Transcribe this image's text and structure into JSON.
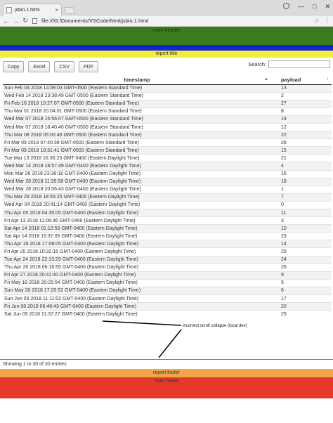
{
  "browser": {
    "tab_title": "jsbin.1.html",
    "tab_close": "×",
    "url": "file:///G:/Documents/VSCode/html/jsbin.1.html",
    "back": "←",
    "forward": "→",
    "reload": "↻",
    "star": "☆",
    "menu": "⋮",
    "minimize": "—",
    "maximize": "□",
    "close": "✕"
  },
  "page": {
    "main_header": "main header",
    "report_title": "report title",
    "report_footer": "report footer",
    "main_footer": "main footer"
  },
  "toolbar": {
    "copy": "Copy",
    "excel": "Excel",
    "csv": "CSV",
    "pdf": "PDF",
    "search_label": "Search:",
    "search_value": ""
  },
  "table": {
    "headers": [
      "timestamp",
      "payload"
    ],
    "sort_icon": "▲",
    "sort_icon2": "↕",
    "rows": [
      [
        "Sun Feb 04 2018 14:58:03 GMT-0500 (Eastern Standard Time)",
        "13"
      ],
      [
        "Wed Feb 14 2018 23:38:49 GMT-0500 (Eastern Standard Time)",
        "2"
      ],
      [
        "Fri Feb 16 2018 10:27:07 GMT-0500 (Eastern Standard Time)",
        "27"
      ],
      [
        "Thu Mar 01 2018 20:04:01 GMT-0500 (Eastern Standard Time)",
        "8"
      ],
      [
        "Wed Mar 07 2018 15:56:07 GMT-0500 (Eastern Standard Time)",
        "19"
      ],
      [
        "Wed Mar 07 2018 18:40:40 GMT-0500 (Eastern Standard Time)",
        "12"
      ],
      [
        "Thu Mar 08 2018 05:00:46 GMT-0500 (Eastern Standard Time)",
        "22"
      ],
      [
        "Fri Mar 09 2018 07:40:38 GMT-0500 (Eastern Standard Time)",
        "28"
      ],
      [
        "Fri Mar 09 2018 19:31:41 GMT-0500 (Eastern Standard Time)",
        "15"
      ],
      [
        "Tue Mar 13 2018 16:36:23 GMT-0400 (Eastern Daylight Time)",
        "21"
      ],
      [
        "Wed Mar 14 2018 18:57:49 GMT-0400 (Eastern Daylight Time)",
        "4"
      ],
      [
        "Mon Mar 26 2018 23:38:18 GMT-0400 (Eastern Daylight Time)",
        "16"
      ],
      [
        "Wed Mar 28 2018 11:35:58 GMT-0400 (Eastern Daylight Time)",
        "18"
      ],
      [
        "Wed Mar 28 2018 20:06:43 GMT-0400 (Eastern Daylight Time)",
        "1"
      ],
      [
        "Thu Mar 29 2018 18:55:25 GMT-0400 (Eastern Daylight Time)",
        "7"
      ],
      [
        "Wed Apr 04 2018 20:41:14 GMT-0400 (Eastern Daylight Time)",
        "0"
      ],
      [
        "Thu Apr 05 2018 04:35:05 GMT-0400 (Eastern Daylight Time)",
        "11"
      ],
      [
        "Fri Apr 13 2018 11:06:36 GMT-0400 (Eastern Daylight Time)",
        "3"
      ],
      [
        "Sat Apr 14 2018 01:12:53 GMT-0400 (Eastern Daylight Time)",
        "10"
      ],
      [
        "Sat Apr 14 2018 15:37:05 GMT-0400 (Eastern Daylight Time)",
        "23"
      ],
      [
        "Thu Apr 19 2018 17:08:05 GMT-0400 (Eastern Daylight Time)",
        "14"
      ],
      [
        "Fri Apr 20 2018 10:32:15 GMT-0400 (Eastern Daylight Time)",
        "29"
      ],
      [
        "Tue Apr 24 2018 22:13:29 GMT-0400 (Eastern Daylight Time)",
        "24"
      ],
      [
        "Thu Apr 26 2018 06:16:55 GMT-0400 (Eastern Daylight Time)",
        "26"
      ],
      [
        "Fri Apr 27 2018 20:41:40 GMT-0400 (Eastern Daylight Time)",
        "9"
      ],
      [
        "Fri May 18 2018 20:25:54 GMT-0400 (Eastern Daylight Time)",
        "5"
      ],
      [
        "Sun May 20 2018 17:20:52 GMT-0400 (Eastern Daylight Time)",
        "6"
      ],
      [
        "Sun Jun 03 2018 11:11:02 GMT-0400 (Eastern Daylight Time)",
        "17"
      ],
      [
        "Fri Jun 08 2018 06:46:43 GMT-0400 (Eastern Daylight Time)",
        "20"
      ],
      [
        "Sat Jun 09 2018 11:37:27 GMT-0400 (Eastern Daylight Time)",
        "25"
      ]
    ]
  },
  "annotation": "incorrect scroll collapse (local dev)",
  "status": "Showing 1 to 30 of 30 entries"
}
